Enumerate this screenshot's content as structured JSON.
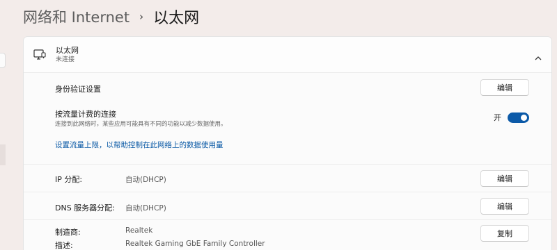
{
  "breadcrumb": {
    "parent": "网络和 Internet",
    "separator": "›",
    "current": "以太网"
  },
  "card": {
    "title": "以太网",
    "status": "未连接",
    "icons": {
      "device": "ethernet-icon",
      "collapse": "chevron-up-icon"
    }
  },
  "auth": {
    "label": "身份验证设置",
    "button": "编辑"
  },
  "metered": {
    "label": "按流量计费的连接",
    "description": "连接到此网络时，某些应用可能具有不同的功能以减少数据使用。",
    "toggle_label": "开",
    "toggle_on": true,
    "accent": "#0c5aa8",
    "link": "设置流量上限，以帮助控制在此网络上的数据使用量"
  },
  "ip": {
    "label": "IP 分配:",
    "value": "自动(DHCP)",
    "button": "编辑"
  },
  "dns": {
    "label": "DNS 服务器分配:",
    "value": "自动(DHCP)",
    "button": "编辑"
  },
  "properties": {
    "manufacturer_label": "制造商:",
    "manufacturer_value": "Realtek",
    "description_label": "描述:",
    "description_value": "Realtek Gaming GbE Family Controller",
    "button": "复制"
  }
}
